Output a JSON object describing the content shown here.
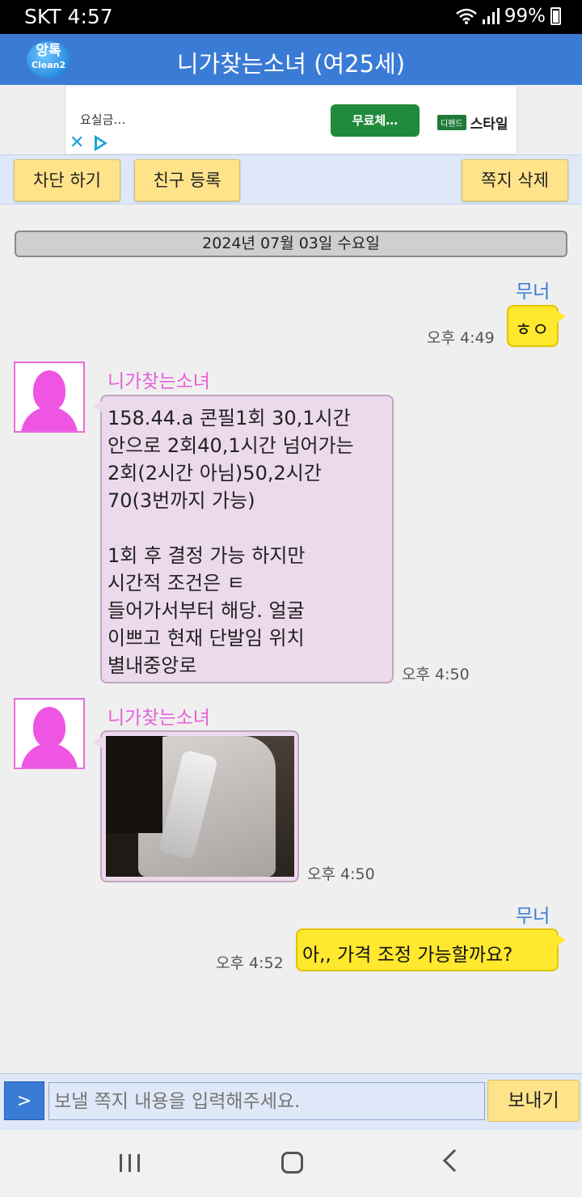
{
  "status_bar": {
    "carrier_time": "SKT 4:57",
    "battery": "99%",
    "icons": [
      "wifi-icon",
      "signal-icon",
      "battery-icon"
    ]
  },
  "header": {
    "logo_top": "앙톡",
    "logo_bottom": "Clean2",
    "title": "니가찾는소녀 (여25세)"
  },
  "ad": {
    "text": "요실금…",
    "button": "무료체…",
    "brand_box": "디펜드",
    "brand_name": "스타일"
  },
  "actions": {
    "block": "차단 하기",
    "add_friend": "친구 등록",
    "delete": "쪽지 삭제"
  },
  "date_divider": "2024년 07월 03일 수요일",
  "messages": [
    {
      "from": "me",
      "sender": "무너",
      "text": "ㅎㅇ",
      "time": "오후 4:49"
    },
    {
      "from": "her",
      "sender": "니가찾는소녀",
      "lines": [
        "158.44.a 콘필1회 30,1시간",
        "안으로 2회40,1시간 넘어가는",
        "2회(2시간 아님)50,2시간",
        "70(3번까지 가능)",
        "",
        "1회 후 결정 가능 하지만",
        "시간적 조건은 ㅌ",
        "들어가서부터 해당. 얼굴",
        "이쁘고 현재 단발임 위치",
        "별내중앙로"
      ],
      "time": "오후 4:50"
    },
    {
      "from": "her",
      "sender": "니가찾는소녀",
      "image": "photo",
      "time": "오후 4:50"
    },
    {
      "from": "me",
      "sender": "무너",
      "text": "아,, 가격 조정 가능할까요?",
      "time": "오후 4:52"
    }
  ],
  "input": {
    "toggle": ">",
    "placeholder": "보낼 쪽지 내용을 입력해주세요.",
    "send": "보내기"
  },
  "colors": {
    "appbar": "#3a7bd5",
    "my_bubble": "#ffe82e",
    "her_bubble": "#ecd9eb",
    "her_name": "#e65fd9",
    "button": "#ffe38a"
  }
}
